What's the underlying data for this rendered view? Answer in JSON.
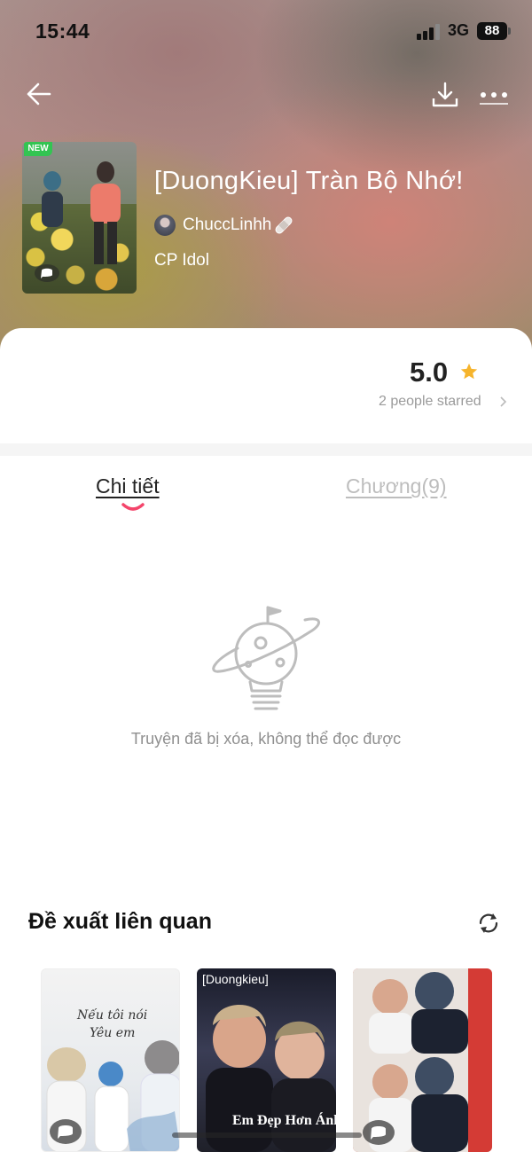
{
  "status_bar": {
    "time": "15:44",
    "network": "3G",
    "battery": "88"
  },
  "story": {
    "badge": "NEW",
    "title": "[DuongKieu] Tràn Bộ Nhớ!",
    "author": "ChuccLinhh",
    "category": "CP Idol"
  },
  "rating": {
    "value": "5.0",
    "count_text": "2 people starred"
  },
  "tabs": [
    {
      "label": "Chi tiết",
      "active": true
    },
    {
      "label": "Chương(9)",
      "active": false
    }
  ],
  "empty_state": {
    "message": "Truyện đã bị xóa, không thể đọc được"
  },
  "related": {
    "title": "Đề xuất liên quan",
    "items": [
      {
        "cover_text_line1": "Nếu tôi nói",
        "cover_text_line2": "Yêu em"
      },
      {
        "tag": "[Duongkieu]",
        "cover_text": "Em Đẹp Hơn Ánh"
      },
      {
        "cover_text": ""
      }
    ]
  },
  "colors": {
    "accent": "#f4456b",
    "star": "#f6b42c",
    "new_badge": "#33c452"
  }
}
